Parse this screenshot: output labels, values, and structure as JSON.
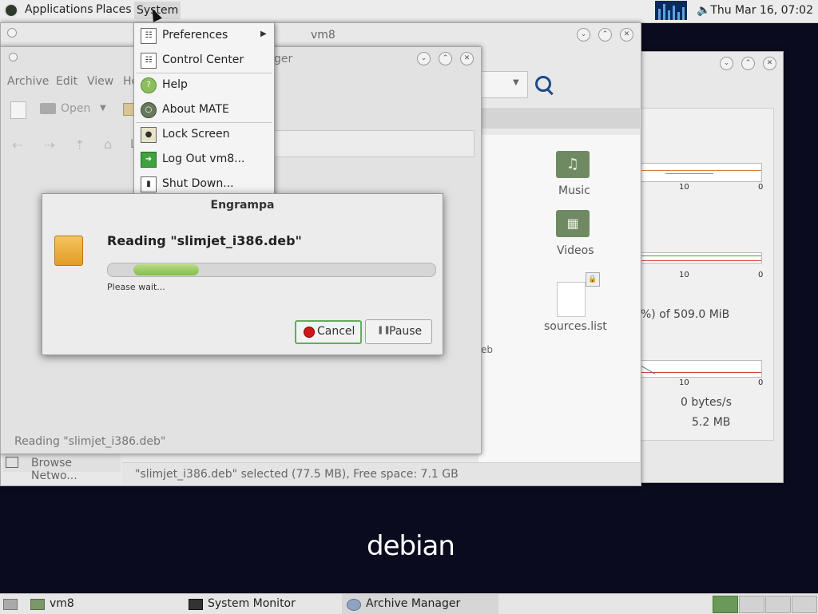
{
  "top_panel": {
    "menus": [
      "Applications",
      "Places",
      "System"
    ],
    "clock": "Thu Mar 16, 07:02"
  },
  "system_menu": {
    "items": [
      {
        "label": "Preferences",
        "icon": "preferences-icon",
        "submenu": true
      },
      {
        "label": "Control Center",
        "icon": "control-center-icon"
      },
      {
        "label": "Help",
        "icon": "help-icon"
      },
      {
        "label": "About MATE",
        "icon": "mate-logo-icon"
      },
      {
        "label": "Lock Screen",
        "icon": "lock-screen-icon"
      },
      {
        "label": "Log Out vm8...",
        "icon": "log-out-icon"
      },
      {
        "label": "Shut Down...",
        "icon": "shut-down-icon"
      }
    ]
  },
  "file_manager": {
    "title": "vm8",
    "files": [
      {
        "label": "Music",
        "icon": "music-folder-icon"
      },
      {
        "label": "Videos",
        "icon": "videos-folder-icon"
      },
      {
        "label": "sources.list",
        "icon": "text-file-icon"
      }
    ],
    "partial_file_label": "eb",
    "sidebar_item": "Browse Netwo...",
    "status": "\"slimjet_i386.deb\" selected (77.5 MB), Free space: 7.1 GB"
  },
  "archive_manager": {
    "title_fragment": "ger",
    "menu": [
      "Archive",
      "Edit",
      "View",
      "He"
    ],
    "toolbar": {
      "open_label": "Open"
    },
    "location_label": "L",
    "status": "Reading \"slimjet_i386.deb\""
  },
  "system_monitor": {
    "axis_ticks": [
      "10",
      "0"
    ],
    "memory_text": "%) of 509.0 MiB",
    "network_rate": "0 bytes/s",
    "network_total": "5.2 MB"
  },
  "dialog": {
    "title": "Engrampa",
    "heading": "Reading \"slimjet_i386.deb\"",
    "sub": "Please wait...",
    "progress": 0.2,
    "cancel_label": "Cancel",
    "pause_label": "Pause"
  },
  "desktop": {
    "logo": "debian"
  },
  "taskbar": {
    "tasks": [
      "vm8",
      "System Monitor",
      "Archive Manager"
    ]
  }
}
